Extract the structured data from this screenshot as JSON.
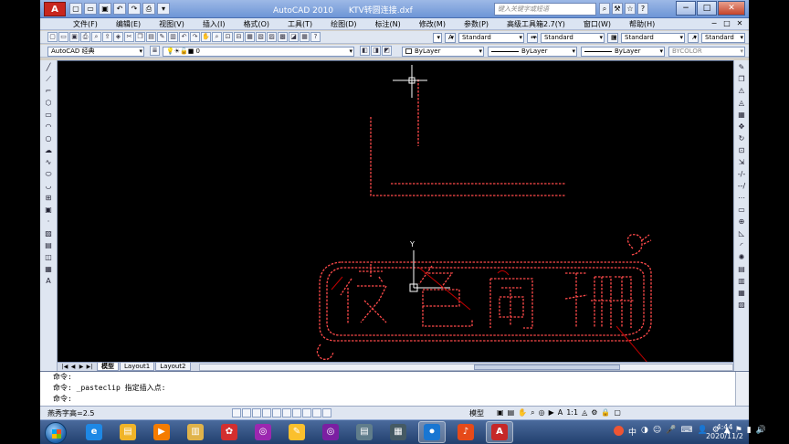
{
  "window": {
    "app_title": "AutoCAD 2010",
    "doc_title": "KTV转圆连接.dxf",
    "search_placeholder": "键入关键字或短语",
    "logo": "A",
    "minimize": "−",
    "maximize": "□",
    "close": "✕"
  },
  "menu": {
    "items": [
      "文件(F)",
      "编辑(E)",
      "视图(V)",
      "插入(I)",
      "格式(O)",
      "工具(T)",
      "绘图(D)",
      "标注(N)",
      "修改(M)",
      "参数(P)",
      "高级工具箱2.7(Y)",
      "窗口(W)",
      "帮助(H)"
    ],
    "mdi": [
      "−",
      "□",
      "✕"
    ]
  },
  "toolbar1": {
    "text_style": "Standard",
    "dim_style": "Standard",
    "table_style": "Standard",
    "mleader_style": "Standard"
  },
  "toolbar2": {
    "workspace": "AutoCAD 经典",
    "layer": "0",
    "color": "ByLayer",
    "linetype": "ByLayer",
    "lineweight": "ByLayer",
    "plotstyle": "BYCOLOR"
  },
  "drawing": {
    "ucs_label": "Y",
    "text_chars": [
      "夜",
      "色",
      "阑",
      "珊"
    ]
  },
  "layout_tabs": [
    "模型",
    "Layout1",
    "Layout2"
  ],
  "command": {
    "lines": [
      "命令:",
      "命令: _pasteclip 指定插入点:",
      "命令:"
    ]
  },
  "status": {
    "coords": "燕秀字高=2.5",
    "model": "模型",
    "scale": "1:1",
    "annotation": "A"
  },
  "tray": {
    "ime": "中",
    "time": "4:44",
    "date": "2020/11/2"
  },
  "colors": {
    "drawing_bg": "#000000",
    "entity_red": "#ff4a4a",
    "entity_dark_red": "#c00000",
    "entity_white": "#ffffff",
    "crosshair": "#ffffff"
  }
}
